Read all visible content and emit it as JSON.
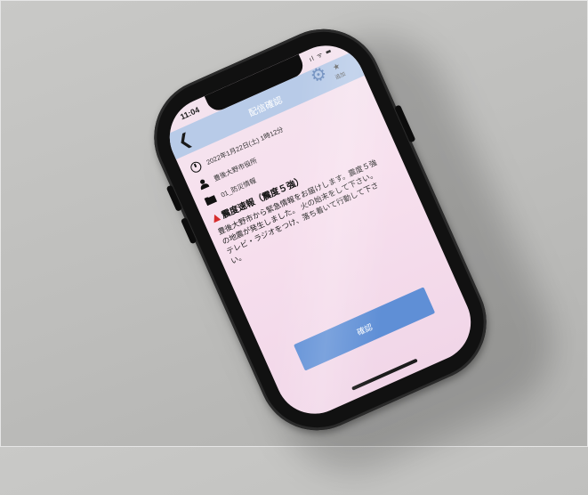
{
  "status_bar": {
    "time": "11:04",
    "icons": "ıl ᯤ ▬"
  },
  "nav": {
    "back_glyph": "❮",
    "title": "配信確認",
    "gear_glyph": "⚙",
    "star_glyph": "★",
    "star_label": "追加"
  },
  "details": {
    "datetime": "2022年1月22日(土) 1時12分",
    "sender": "豊後大野市役所",
    "category": "01_防災情報"
  },
  "message": {
    "title": "震度速報（震度５強）",
    "body": "豊後大野市から緊急情報をお届けします。震度５強の地震が発生しました。 火の始末をして下さい。 テレビ・ラジオをつけ、落ち着いて行動して下さい。"
  },
  "actions": {
    "confirm_label": "確認"
  },
  "colors": {
    "nav_bar": "#b8cbe8",
    "button": "#5f8fd6",
    "warning": "#d62c2c",
    "screen": "#f6e1ee",
    "case": "#111111"
  }
}
